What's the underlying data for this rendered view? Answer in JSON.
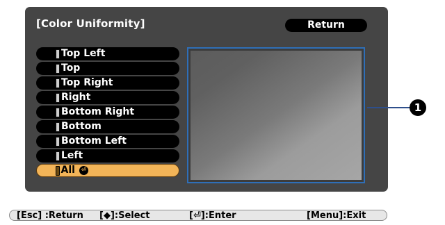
{
  "title": "[Color Uniformity]",
  "return_label": "Return",
  "menu": {
    "items": [
      {
        "label": "Top Left",
        "selected": false
      },
      {
        "label": "Top",
        "selected": false
      },
      {
        "label": "Top Right",
        "selected": false
      },
      {
        "label": "Right",
        "selected": false
      },
      {
        "label": "Bottom Right",
        "selected": false
      },
      {
        "label": "Bottom",
        "selected": false
      },
      {
        "label": "Bottom Left",
        "selected": false
      },
      {
        "label": "Left",
        "selected": false
      },
      {
        "label": "All",
        "selected": true
      }
    ],
    "selected_icon": "enter-icon"
  },
  "callout": {
    "number": "1"
  },
  "footer": {
    "esc": "[Esc] :Return",
    "select": "[◆]:Select",
    "enter": "[⏎]:Enter",
    "menu": "[Menu]:Exit"
  },
  "colors": {
    "osd_bg": "#454545",
    "selected_bg": "#f2b458",
    "preview_border": "#2f6fb8",
    "callout_line": "#2e4f8c"
  }
}
